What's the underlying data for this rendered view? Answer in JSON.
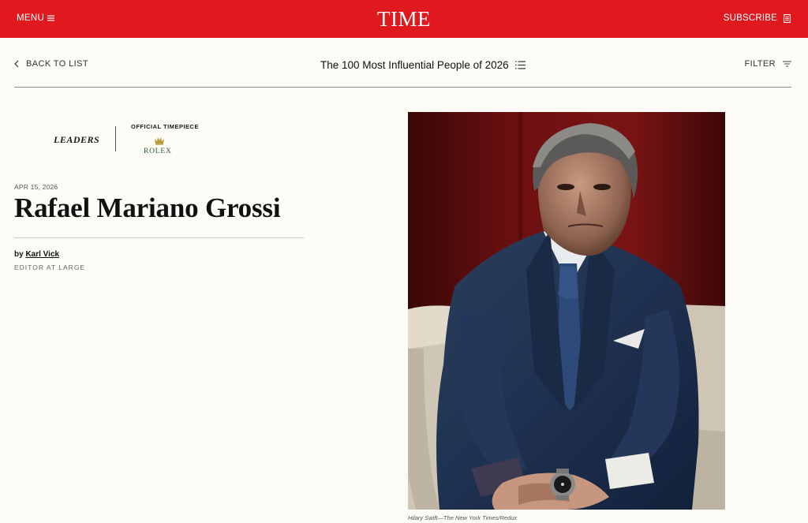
{
  "header": {
    "menu_label": "MENU",
    "logo": "TIME",
    "subscribe_label": "SUBSCRIBE",
    "brand_color": "#e0191f"
  },
  "subnav": {
    "back_label": "BACK TO LIST",
    "list_title": "The 100 Most Influential People of 2026",
    "filter_label": "FILTER"
  },
  "sponsor": {
    "category": "LEADERS",
    "official_label": "OFFICIAL TIMEPIECE",
    "brand": "ROLEX"
  },
  "article": {
    "date": "APR 15, 2026",
    "title": "Rafael Mariano Grossi",
    "by_prefix": "by",
    "author": "Karl Vick",
    "author_role": "EDITOR AT LARGE"
  },
  "photo": {
    "credit": "Hilary Swift—The New York Times/Redux"
  }
}
